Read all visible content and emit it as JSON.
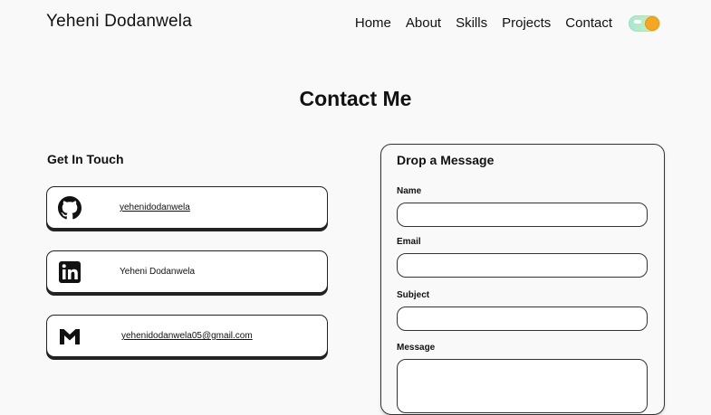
{
  "header": {
    "brand": "Yeheni Dodanwela",
    "nav": [
      "Home",
      "About",
      "Skills",
      "Projects",
      "Contact"
    ]
  },
  "page_title": "Contact Me",
  "get_in_touch": {
    "title": "Get In Touch",
    "cards": [
      {
        "icon": "github-icon",
        "text": "yehenidodanwela"
      },
      {
        "icon": "linkedin-icon",
        "text": "Yeheni Dodanwela"
      },
      {
        "icon": "gmail-icon",
        "text": "yehenidodanwela05@gmail.com"
      }
    ]
  },
  "form": {
    "title": "Drop a Message",
    "name_label": "Name",
    "email_label": "Email",
    "subject_label": "Subject",
    "message_label": "Message"
  },
  "colors": {
    "background": "#f9f9f9",
    "border": "#222222",
    "toggle_sun": "#f5a623"
  }
}
